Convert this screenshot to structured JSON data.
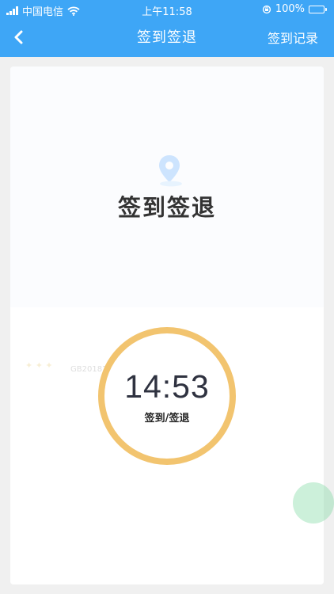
{
  "status_bar": {
    "carrier": "中国电信",
    "time": "上午11:58",
    "battery": "100%"
  },
  "nav": {
    "title": "签到签退",
    "action_label": "签到记录"
  },
  "card": {
    "title": "签到签退",
    "watermark_license": "GB2018143号 · 甲测资字1100471",
    "clock": {
      "time": "14:53",
      "label": "签到/签退"
    }
  },
  "colors": {
    "accent": "#3ea6f6",
    "ring": "#f2c46f",
    "floating": "#7ad89e"
  },
  "icons": [
    "signal-icon",
    "wifi-icon",
    "orientation-lock-icon",
    "battery-icon",
    "back-chevron-icon",
    "location-pin-icon"
  ]
}
